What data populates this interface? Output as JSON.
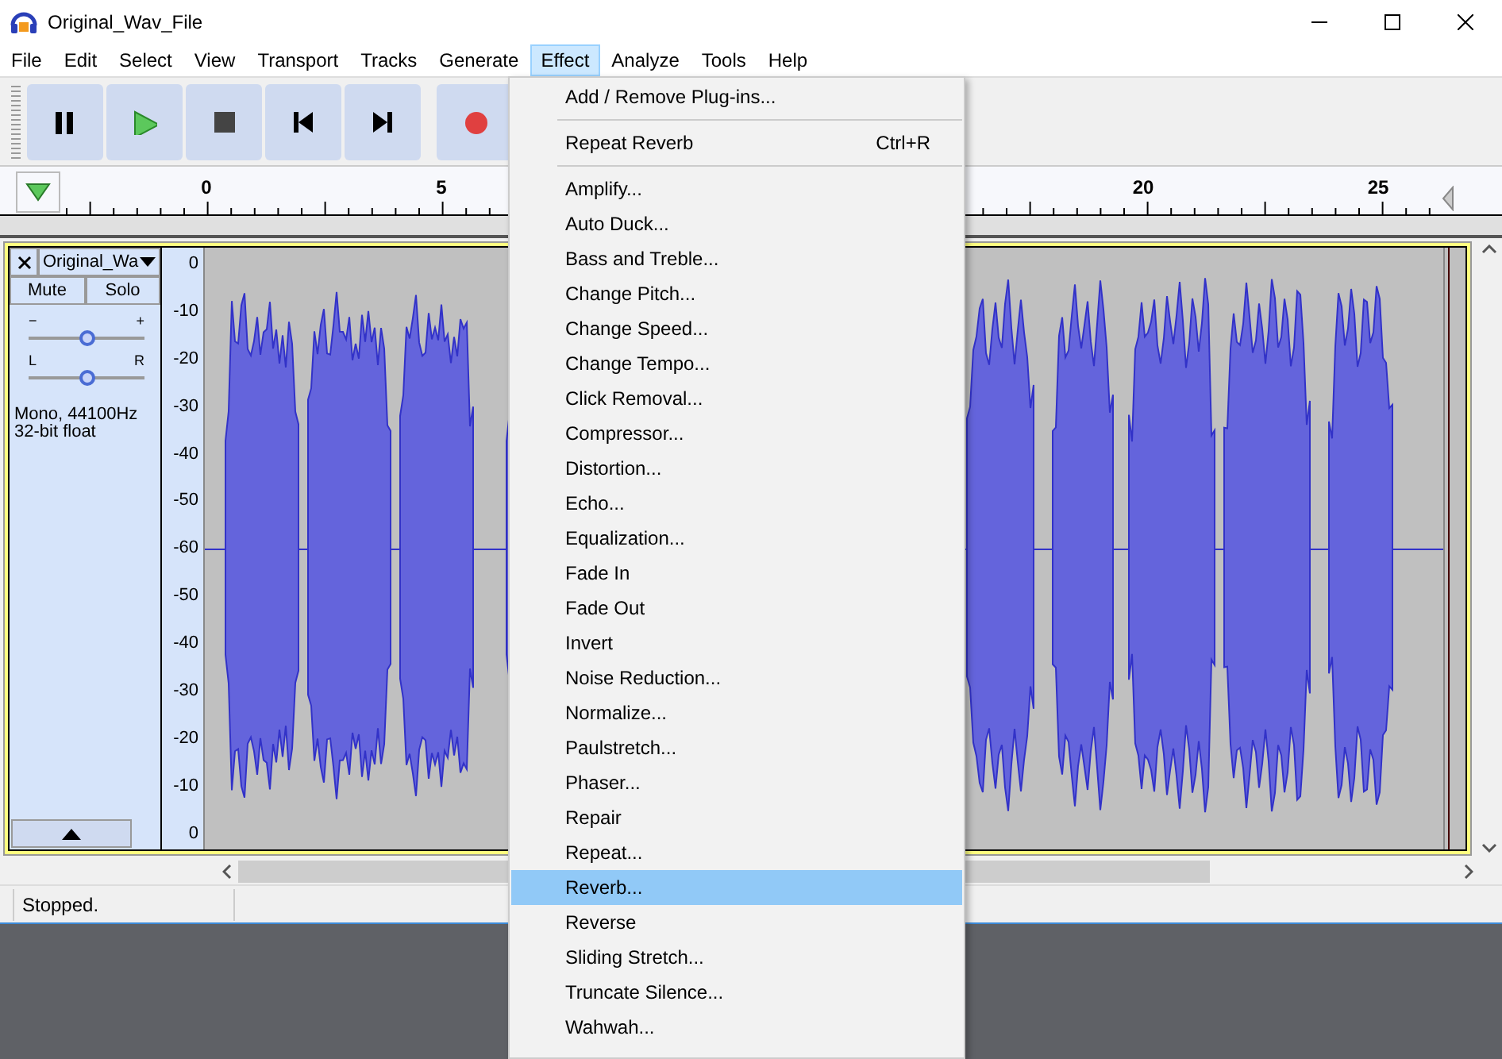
{
  "window": {
    "title": "Original_Wav_File"
  },
  "menu_bar": [
    {
      "label": "File",
      "selected": false
    },
    {
      "label": "Edit",
      "selected": false
    },
    {
      "label": "Select",
      "selected": false
    },
    {
      "label": "View",
      "selected": false
    },
    {
      "label": "Transport",
      "selected": false
    },
    {
      "label": "Tracks",
      "selected": false
    },
    {
      "label": "Generate",
      "selected": false
    },
    {
      "label": "Effect",
      "selected": true
    },
    {
      "label": "Analyze",
      "selected": false
    },
    {
      "label": "Tools",
      "selected": false
    },
    {
      "label": "Help",
      "selected": false
    }
  ],
  "transport_buttons": [
    {
      "kind": "pause"
    },
    {
      "kind": "play"
    },
    {
      "kind": "stop"
    },
    {
      "kind": "skip_start"
    },
    {
      "kind": "skip_end"
    },
    {
      "kind": "record"
    }
  ],
  "ruler": {
    "ticks": [
      "0",
      "5",
      "20",
      "25"
    ]
  },
  "track": {
    "name": "Original_Wa",
    "buttons": [
      "Mute",
      "Solo"
    ],
    "gain_slider": {
      "min_label": "−",
      "max_label": "+",
      "level": 0.5
    },
    "pan_slider": {
      "min_label": "L",
      "max_label": "R",
      "level": 0.5
    },
    "info": [
      "Mono, 44100Hz",
      "32-bit float"
    ]
  },
  "scale_labels": [
    "0",
    "-10",
    "-20",
    "-30",
    "-40",
    "-50",
    "-60",
    "-50",
    "-40",
    "-30",
    "-20",
    "-10",
    "0"
  ],
  "status_bar": {
    "text": "Stopped."
  },
  "effect_menu": {
    "items": [
      {
        "kind": "item",
        "label": "Add / Remove Plug-ins...",
        "selected": false
      },
      {
        "kind": "separator"
      },
      {
        "kind": "item",
        "label": "Repeat Reverb",
        "shortcut": "Ctrl+R",
        "selected": false
      },
      {
        "kind": "separator"
      },
      {
        "kind": "item",
        "label": "Amplify...",
        "selected": false
      },
      {
        "kind": "item",
        "label": "Auto Duck...",
        "selected": false
      },
      {
        "kind": "item",
        "label": "Bass and Treble...",
        "selected": false
      },
      {
        "kind": "item",
        "label": "Change Pitch...",
        "selected": false
      },
      {
        "kind": "item",
        "label": "Change Speed...",
        "selected": false
      },
      {
        "kind": "item",
        "label": "Change Tempo...",
        "selected": false
      },
      {
        "kind": "item",
        "label": "Click Removal...",
        "selected": false
      },
      {
        "kind": "item",
        "label": "Compressor...",
        "selected": false
      },
      {
        "kind": "item",
        "label": "Distortion...",
        "selected": false
      },
      {
        "kind": "item",
        "label": "Echo...",
        "selected": false
      },
      {
        "kind": "item",
        "label": "Equalization...",
        "selected": false
      },
      {
        "kind": "item",
        "label": "Fade In",
        "selected": false
      },
      {
        "kind": "item",
        "label": "Fade Out",
        "selected": false
      },
      {
        "kind": "item",
        "label": "Invert",
        "selected": false
      },
      {
        "kind": "item",
        "label": "Noise Reduction...",
        "selected": false
      },
      {
        "kind": "item",
        "label": "Normalize...",
        "selected": false
      },
      {
        "kind": "item",
        "label": "Paulstretch...",
        "selected": false
      },
      {
        "kind": "item",
        "label": "Phaser...",
        "selected": false
      },
      {
        "kind": "item",
        "label": "Repair",
        "selected": false
      },
      {
        "kind": "item",
        "label": "Repeat...",
        "selected": false
      },
      {
        "kind": "item",
        "label": "Reverb...",
        "selected": true
      },
      {
        "kind": "item",
        "label": "Reverse",
        "selected": false
      },
      {
        "kind": "item",
        "label": "Sliding Stretch...",
        "selected": false
      },
      {
        "kind": "item",
        "label": "Truncate Silence...",
        "selected": false
      },
      {
        "kind": "item",
        "label": "Wahwah...",
        "selected": false
      }
    ]
  }
}
